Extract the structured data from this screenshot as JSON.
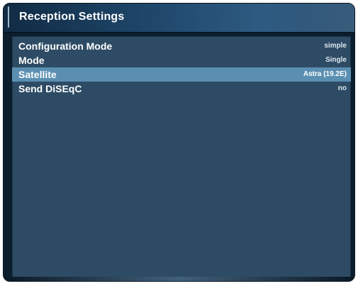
{
  "window": {
    "title": "Reception Settings"
  },
  "settings": [
    {
      "label": "Configuration Mode",
      "value": "simple"
    },
    {
      "label": "Mode",
      "value": "Single"
    },
    {
      "label": "Satellite",
      "value": "Astra (19.2E)"
    },
    {
      "label": "Send DiSEqC",
      "value": "no"
    }
  ],
  "selected_index": 2,
  "colors": {
    "panel": "#2d4b64",
    "selection": "#5b8fb2",
    "title_bar": "#1e4669"
  }
}
